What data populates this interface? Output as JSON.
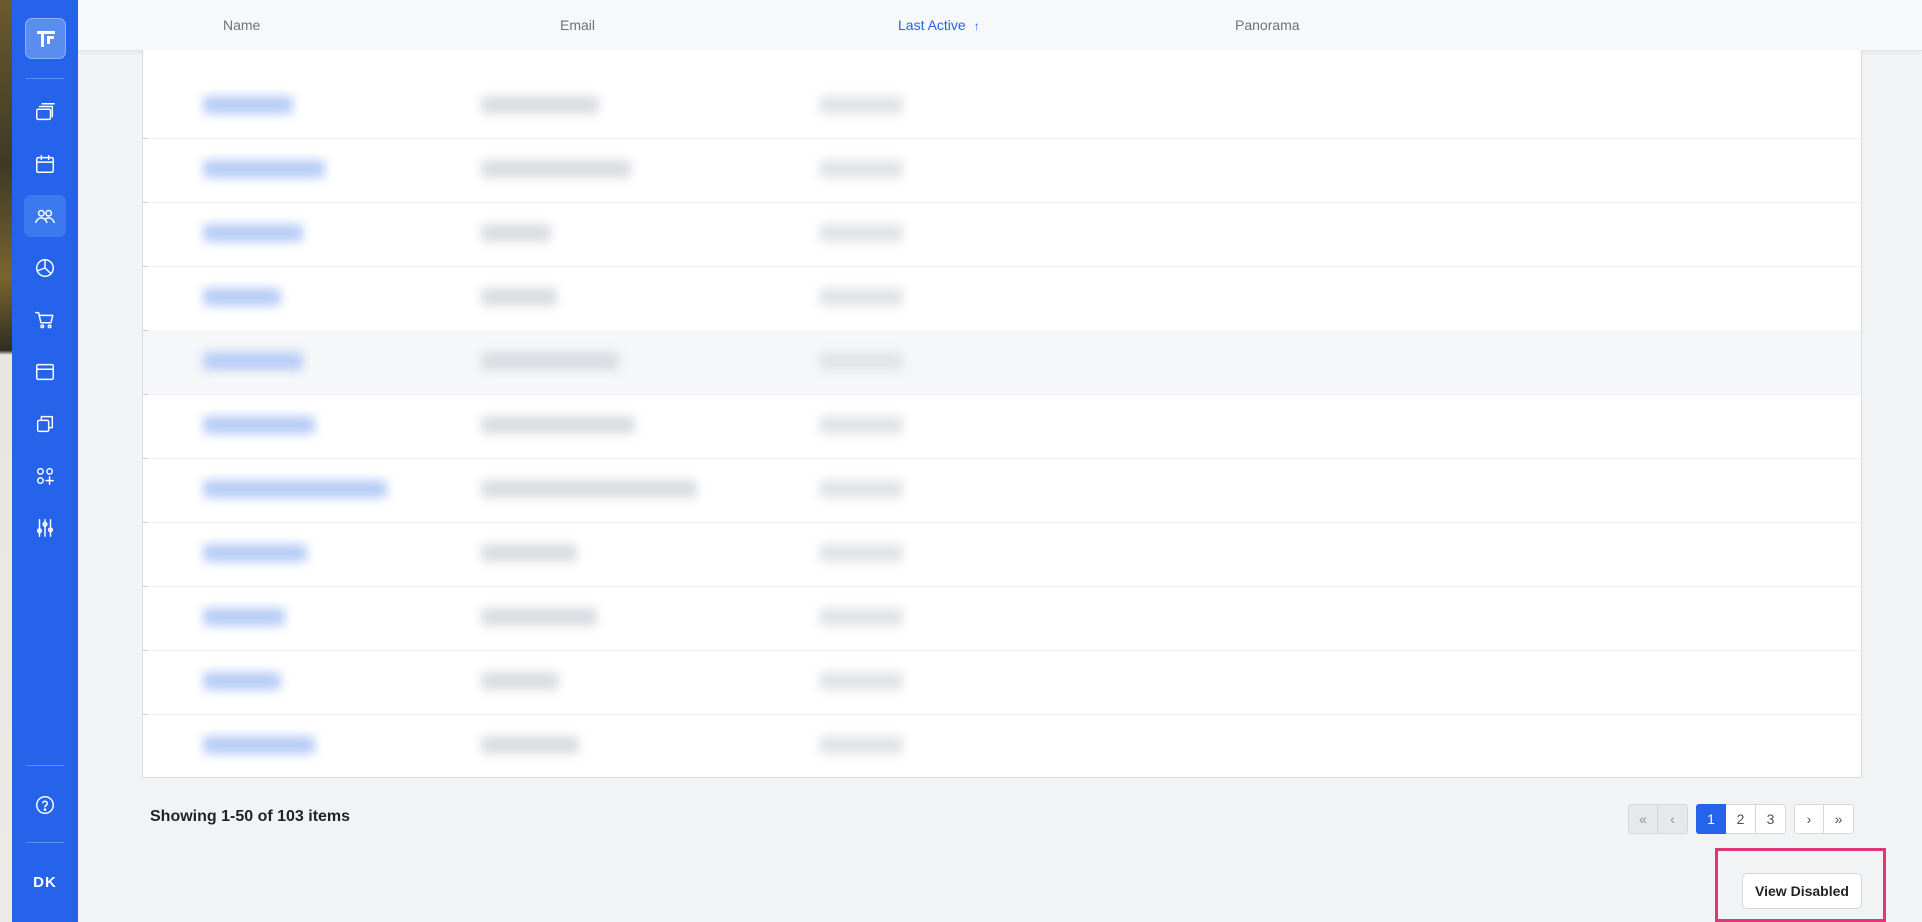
{
  "sidebar": {
    "logo_icon": "brand-logo-icon",
    "nav_items": [
      {
        "icon": "stack-icon"
      },
      {
        "icon": "calendar-icon"
      },
      {
        "icon": "users-icon",
        "active": true
      },
      {
        "icon": "pie-chart-icon"
      },
      {
        "icon": "cart-icon"
      },
      {
        "icon": "window-icon"
      },
      {
        "icon": "copy-icon"
      },
      {
        "icon": "apps-add-icon"
      },
      {
        "icon": "sliders-icon"
      }
    ],
    "help_icon": "help-circle-icon",
    "avatar_initials": "DK"
  },
  "table": {
    "columns": {
      "name": "Name",
      "email": "Email",
      "last_active": "Last Active",
      "panorama": "Panorama"
    },
    "sorted_column": "last_active",
    "sort_direction_icon": "↑"
  },
  "footer": {
    "summary": "Showing 1-50 of 103 items",
    "pagination": {
      "first_icon": "«",
      "prev_icon": "‹",
      "pages": [
        "1",
        "2",
        "3"
      ],
      "current": "1",
      "next_icon": "›",
      "last_icon": "»"
    },
    "view_disabled_label": "View Disabled"
  },
  "colors": {
    "sidebar": "#2563eb",
    "accent": "#2563eb",
    "highlight": "#e0357b"
  }
}
